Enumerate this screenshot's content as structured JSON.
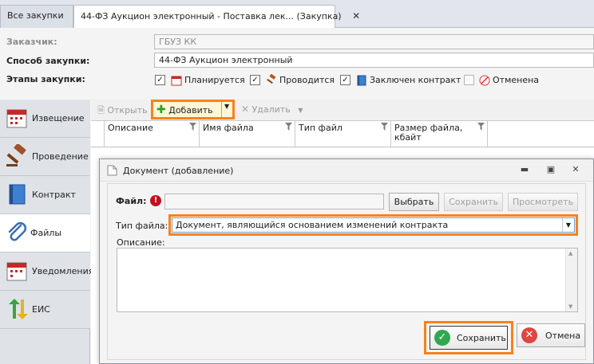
{
  "tabs": [
    {
      "label": "Все закупки"
    },
    {
      "label": "44-ФЗ Аукцион электронный - Поставка лек... (Закупка)",
      "close": "✕"
    }
  ],
  "form": {
    "customer_label": "Заказчик:",
    "customer_value": "ГБУЗ КК",
    "method_label": "Способ закупки:",
    "method_value": "44-ФЗ Аукцион электронный",
    "stages_label": "Этапы закупки:",
    "stages": [
      {
        "label": "Планируется",
        "checked": true
      },
      {
        "label": "Проводится",
        "checked": true
      },
      {
        "label": "Заключен контракт",
        "checked": true
      },
      {
        "label": "Отменена",
        "checked": false
      }
    ]
  },
  "nav": [
    {
      "label": "Извещение",
      "icon": "calendar-icon"
    },
    {
      "label": "Проведение",
      "icon": "gavel-icon"
    },
    {
      "label": "Контракт",
      "icon": "book-icon"
    },
    {
      "label": "Файлы",
      "icon": "paperclip-icon",
      "active": true
    },
    {
      "label": "Уведомления",
      "icon": "calendar-icon"
    },
    {
      "label": "ЕИС",
      "icon": "arrows-icon"
    }
  ],
  "toolbar": {
    "open": "Открыть",
    "add": "Добавить",
    "delete": "Удалить"
  },
  "grid": {
    "columns": [
      "Описание",
      "Имя файла",
      "Тип файл",
      "Размер файла, кбайт"
    ]
  },
  "dialog": {
    "title": "Документ (добавление)",
    "file_label": "Файл:",
    "file_value": "",
    "browse": "Выбрать",
    "save_file": "Сохранить",
    "view": "Просмотреть",
    "type_label": "Тип файла:",
    "type_value": "Документ, являющийся основанием изменений контракта",
    "desc_label": "Описание:",
    "desc_value": "",
    "save": "Сохранить",
    "cancel": "Отмена"
  },
  "colors": {
    "highlight": "#f58220",
    "save_green": "#2fa84f",
    "cancel_red": "#e0463f"
  }
}
